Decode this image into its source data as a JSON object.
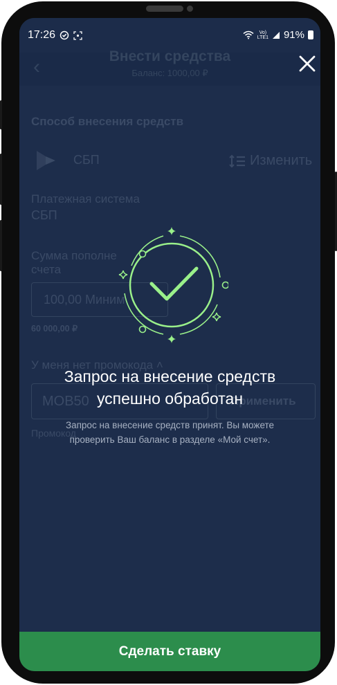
{
  "status_bar": {
    "time": "17:26",
    "network_top": "Vo)",
    "network_bottom": "LTE1",
    "battery": "91%"
  },
  "header": {
    "title": "Внести средства",
    "balance": "Баланс: 1000,00 ₽"
  },
  "form": {
    "section_title": "Способ внесения средств",
    "method_name": "СБП",
    "change_label": "Изменить",
    "payment_system_label": "Платежная система",
    "payment_system_value": "СБП",
    "amount_label_line1": "Сумма пополне",
    "amount_label_line2": "счета",
    "amount_placeholder": "100,00 Миним",
    "max_amount": "60 000,00 ₽",
    "promo_toggle": "У меня нет промокода",
    "promo_value": "MOB50",
    "promo_apply": "Применить",
    "promo_hint": "Промокод"
  },
  "success": {
    "title_line1": "Запрос на внесение средств",
    "title_line2": "успешно обработан",
    "text_line1": "Запрос на внесение средств принят. Вы можете",
    "text_line2": "проверить Ваш баланс в разделе «Мой счет»."
  },
  "bet_button_label": "Сделать ставку",
  "colors": {
    "background": "#1d2d4b",
    "accent_green": "#9af08a",
    "button_green": "#2c8d4c"
  }
}
